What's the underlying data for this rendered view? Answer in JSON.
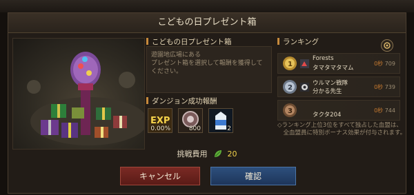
{
  "dialog": {
    "title": "こどもの日プレゼント箱"
  },
  "event": {
    "heading": "こどもの日プレゼント箱",
    "description": "遊園地広場にある\nプレゼント箱を選択して報酬を獲得してください。"
  },
  "rewards": {
    "heading": "ダンジョン成功報酬",
    "items": [
      {
        "icon": "exp-icon",
        "count": "0.00%"
      },
      {
        "icon": "coin-icon",
        "count": "800"
      },
      {
        "icon": "milk-carton-icon",
        "count": "2"
      }
    ]
  },
  "ranking": {
    "heading": "ランキング",
    "entries": [
      {
        "rank": "1",
        "guild": "Forests",
        "player": "タマタマタマム",
        "time_min": "0秒",
        "time_val": "709"
      },
      {
        "rank": "2",
        "guild": "ウルマン戦隊",
        "player": "分かる先生",
        "time_min": "0秒",
        "time_val": "739"
      },
      {
        "rank": "3",
        "guild": "",
        "player": "タクタ204",
        "time_min": "0秒",
        "time_val": "744"
      }
    ],
    "note": "◇ランキング上位3位をすべて独占した血盟は、\n　全血盟員に特別ボーナス効果が付与されます。"
  },
  "cost": {
    "label": "挑戦費用",
    "value": "20"
  },
  "buttons": {
    "cancel": "キャンセル",
    "confirm": "確認"
  },
  "colors": {
    "accent": "#c78a3c",
    "cancel": "#7a2a24",
    "confirm": "#2d4f7c",
    "time": "#c77a30",
    "cost": "#f2d24a"
  }
}
